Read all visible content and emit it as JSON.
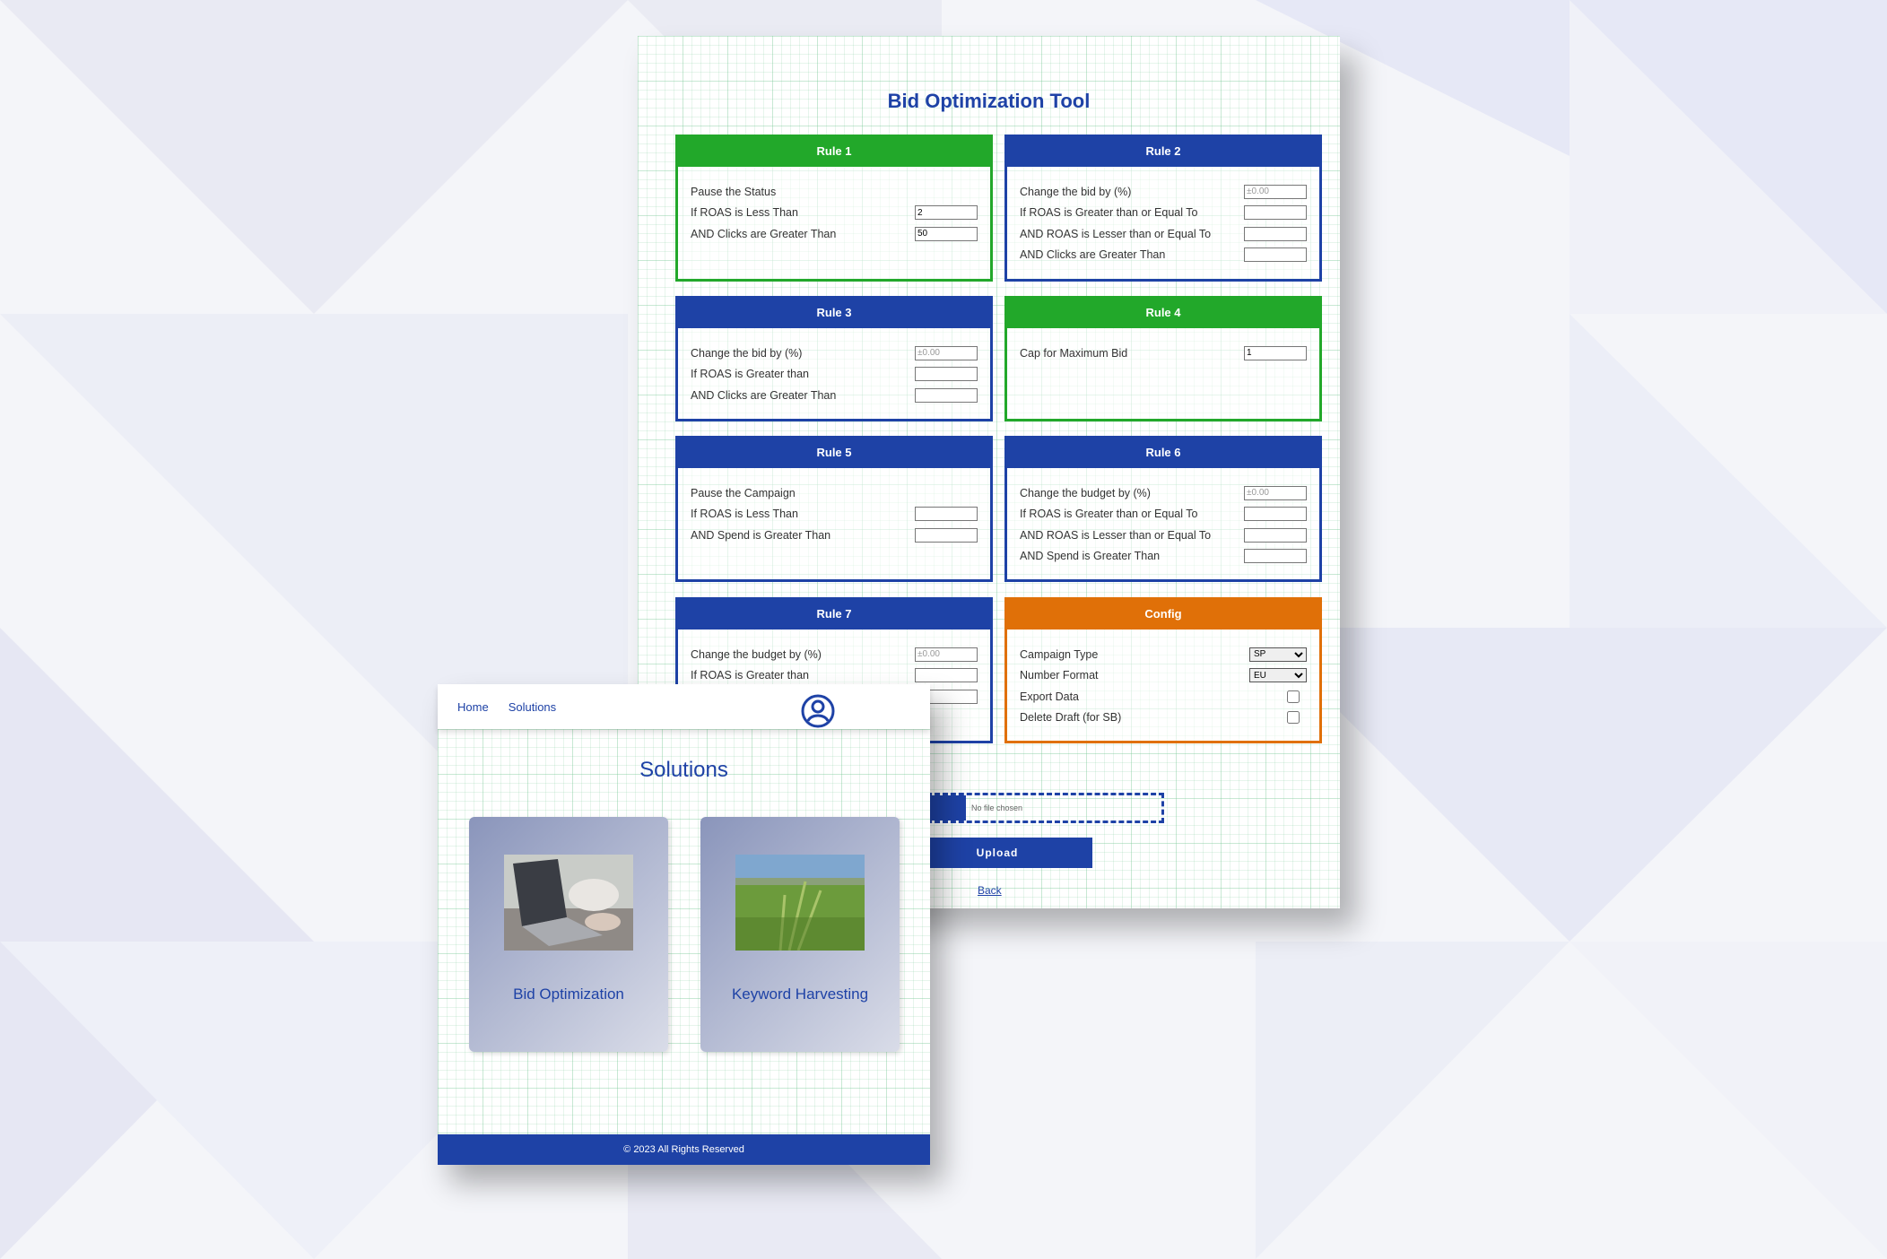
{
  "colors": {
    "blue": "#1e42a6",
    "green": "#22a82a",
    "orange": "#e07008"
  },
  "tool": {
    "title": "Bid Optimization Tool",
    "rules": [
      {
        "title": "Rule 1",
        "color": "green",
        "rows": [
          {
            "label": "Pause the Status"
          },
          {
            "label": "If ROAS is Less Than",
            "value": "2"
          },
          {
            "label": "AND Clicks are Greater Than",
            "value": "50"
          }
        ]
      },
      {
        "title": "Rule 2",
        "color": "blue",
        "rows": [
          {
            "label": "Change the bid by (%)",
            "placeholder": "±0.00"
          },
          {
            "label": "If ROAS is Greater than or Equal To",
            "value": ""
          },
          {
            "label": "AND ROAS is Lesser than or Equal To",
            "value": ""
          },
          {
            "label": "AND Clicks are Greater Than",
            "value": ""
          }
        ]
      },
      {
        "title": "Rule 3",
        "color": "blue",
        "rows": [
          {
            "label": "Change the bid by (%)",
            "placeholder": "±0.00"
          },
          {
            "label": "If ROAS is Greater than",
            "value": ""
          },
          {
            "label": "AND Clicks are Greater Than",
            "value": ""
          }
        ]
      },
      {
        "title": "Rule 4",
        "color": "green",
        "rows": [
          {
            "label": "Cap for Maximum Bid",
            "value": "1"
          }
        ]
      },
      {
        "title": "Rule 5",
        "color": "blue",
        "rows": [
          {
            "label": "Pause the Campaign"
          },
          {
            "label": "If ROAS is Less Than",
            "value": ""
          },
          {
            "label": "AND Spend is Greater Than",
            "value": ""
          }
        ]
      },
      {
        "title": "Rule 6",
        "color": "blue",
        "rows": [
          {
            "label": "Change the budget by (%)",
            "placeholder": "±0.00"
          },
          {
            "label": "If ROAS is Greater than or Equal To",
            "value": ""
          },
          {
            "label": "AND ROAS is Lesser than or Equal To",
            "value": ""
          },
          {
            "label": "AND Spend is Greater Than",
            "value": ""
          }
        ]
      },
      {
        "title": "Rule 7",
        "color": "blue",
        "rows": [
          {
            "label": "Change the budget by (%)",
            "placeholder": "±0.00"
          },
          {
            "label": "If ROAS is Greater than",
            "value": ""
          },
          {
            "label": "",
            "value": ""
          }
        ]
      },
      {
        "title": "Config",
        "color": "orange",
        "rows": [
          {
            "label": "Campaign Type",
            "select": "SP"
          },
          {
            "label": "Number Format",
            "select": "EU"
          },
          {
            "label": "Export Data",
            "checkbox": false
          },
          {
            "label": "Delete Draft (for SB)",
            "checkbox": false
          }
        ]
      }
    ],
    "file_status": "No file chosen",
    "upload_label": "Upload",
    "back_label": "Back"
  },
  "solutions": {
    "nav": {
      "home": "Home",
      "solutions": "Solutions",
      "avatar_icon": "user-circle-icon"
    },
    "title": "Solutions",
    "cards": [
      {
        "label": "Bid Optimization"
      },
      {
        "label": "Keyword Harvesting"
      }
    ],
    "footer": "© 2023 All Rights Reserved"
  }
}
